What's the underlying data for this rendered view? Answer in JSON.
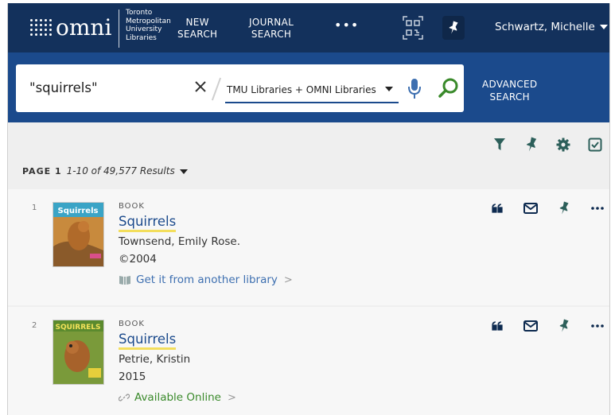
{
  "header": {
    "logo_text": "omni",
    "institution": [
      "Toronto",
      "Metropolitan",
      "University",
      "Libraries"
    ],
    "nav": {
      "new_search": [
        "NEW",
        "SEARCH"
      ],
      "journal_search": [
        "JOURNAL",
        "SEARCH"
      ],
      "more": "•••"
    },
    "user_name": "Schwartz, Michelle"
  },
  "search": {
    "query": "\"squirrels\"",
    "scope": "TMU Libraries + OMNI Libraries",
    "advanced": [
      "ADVANCED",
      "SEARCH"
    ]
  },
  "results_info": {
    "page_label": "PAGE 1",
    "range_text": "1-10 of 49,577 Results"
  },
  "results": [
    {
      "number": "1",
      "type": "BOOK",
      "title": "Squirrels",
      "author": "Townsend, Emily Rose.",
      "date": "©2004",
      "availability": "Get it from another library",
      "availability_color": "#3d6fb0",
      "cover_text": "Squirrels"
    },
    {
      "number": "2",
      "type": "BOOK",
      "title": "Squirrels",
      "author": "Petrie, Kristin",
      "date": "2015",
      "availability": "Available Online",
      "availability_color": "#3a8a2b",
      "cover_text": "SQUIRRELS"
    }
  ],
  "colors": {
    "topbar": "#13315c",
    "searchbar": "#1b4a8c",
    "teal_icon": "#2c5f5a",
    "title_underline": "#f3de5c"
  }
}
